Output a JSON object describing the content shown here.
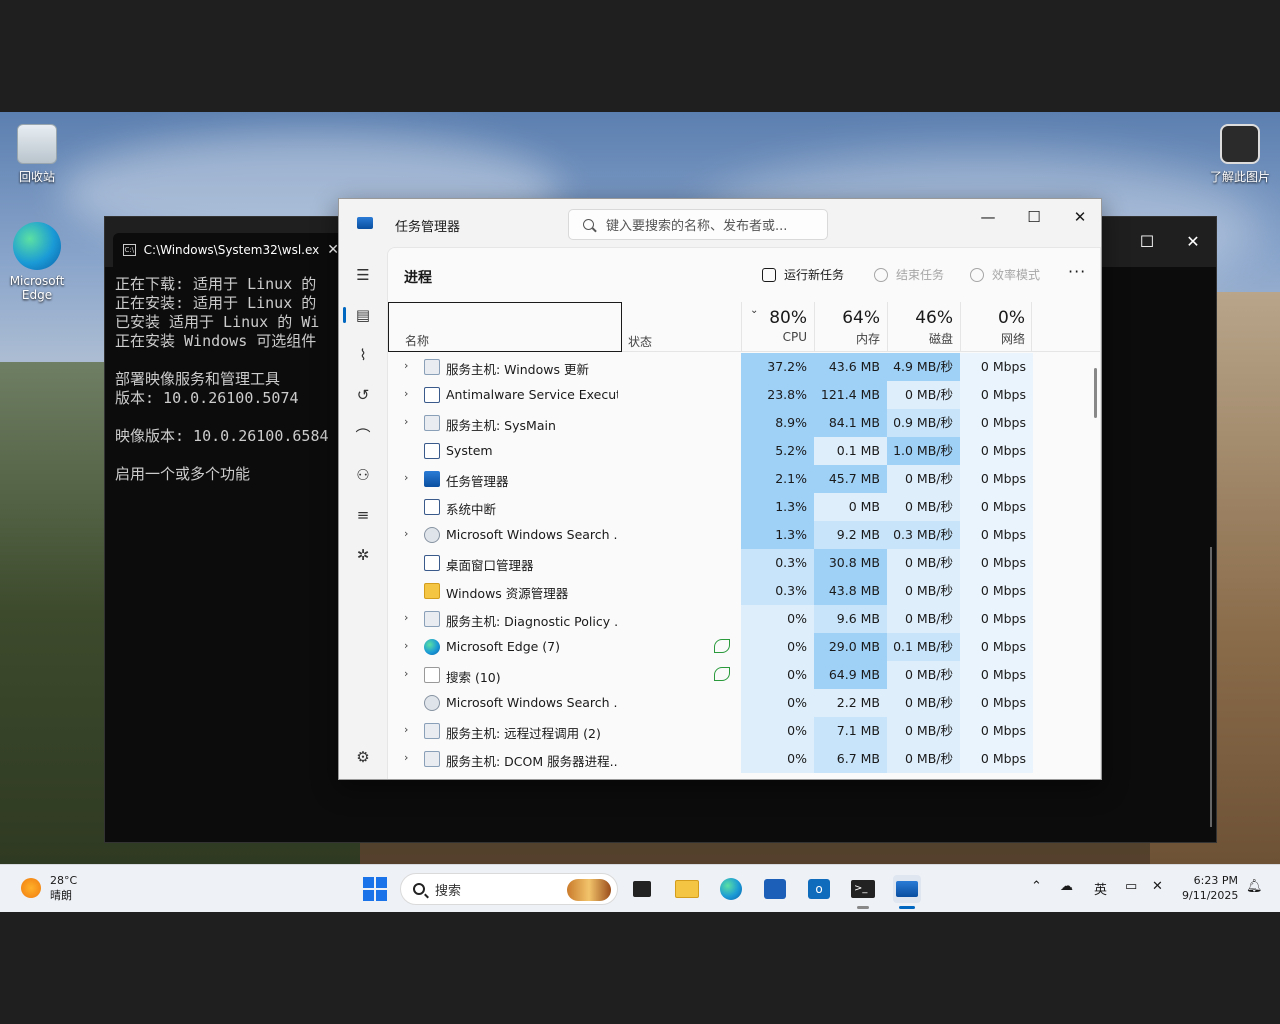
{
  "desktop": {
    "icons": [
      {
        "label": "回收站"
      },
      {
        "label": "Microsoft Edge"
      },
      {
        "label": "了解此图片"
      }
    ]
  },
  "cmd": {
    "tab_title": "C:\\Windows\\System32\\wsl.ex",
    "lines": [
      "正在下载: 适用于 Linux 的",
      "正在安装: 适用于 Linux 的",
      "已安装 适用于 Linux 的 Wi",
      "正在安装 Windows 可选组件",
      "",
      "部署映像服务和管理工具",
      "版本: 10.0.26100.5074",
      "",
      "映像版本: 10.0.26100.6584",
      "",
      "启用一个或多个功能"
    ]
  },
  "taskmgr": {
    "title": "任务管理器",
    "search_placeholder": "键入要搜索的名称、发布者或...",
    "page_title": "进程",
    "toolbar": {
      "run_new_task": "运行新任务",
      "end_task": "结束任务",
      "efficiency_mode": "效率模式",
      "more": "···"
    },
    "columns": {
      "name": "名称",
      "status": "状态",
      "cpu_pct": "80%",
      "cpu": "CPU",
      "mem_pct": "64%",
      "mem": "内存",
      "disk_pct": "46%",
      "disk": "磁盘",
      "net_pct": "0%",
      "net": "网络"
    },
    "processes": [
      {
        "name": "服务主机: Windows 更新",
        "icon": "gear-icon",
        "expandable": true,
        "eco": false,
        "cpu": "37.2%",
        "mem": "43.6 MB",
        "disk": "4.9 MB/秒",
        "net": "0 Mbps"
      },
      {
        "name": "Antimalware Service Execut...",
        "icon": "app-icon",
        "expandable": true,
        "eco": false,
        "cpu": "23.8%",
        "mem": "121.4 MB",
        "disk": "0 MB/秒",
        "net": "0 Mbps"
      },
      {
        "name": "服务主机: SysMain",
        "icon": "gear-icon",
        "expandable": true,
        "eco": false,
        "cpu": "8.9%",
        "mem": "84.1 MB",
        "disk": "0.9 MB/秒",
        "net": "0 Mbps"
      },
      {
        "name": "System",
        "icon": "app-icon",
        "expandable": false,
        "eco": false,
        "cpu": "5.2%",
        "mem": "0.1 MB",
        "disk": "1.0 MB/秒",
        "net": "0 Mbps"
      },
      {
        "name": "任务管理器",
        "icon": "taskmgr-icon",
        "expandable": true,
        "eco": false,
        "cpu": "2.1%",
        "mem": "45.7 MB",
        "disk": "0 MB/秒",
        "net": "0 Mbps"
      },
      {
        "name": "系统中断",
        "icon": "app-icon",
        "expandable": false,
        "eco": false,
        "cpu": "1.3%",
        "mem": "0 MB",
        "disk": "0 MB/秒",
        "net": "0 Mbps"
      },
      {
        "name": "Microsoft Windows Search ...",
        "icon": "user-icon",
        "expandable": true,
        "eco": false,
        "cpu": "1.3%",
        "mem": "9.2 MB",
        "disk": "0.3 MB/秒",
        "net": "0 Mbps"
      },
      {
        "name": "桌面窗口管理器",
        "icon": "app-icon",
        "expandable": false,
        "eco": false,
        "cpu": "0.3%",
        "mem": "30.8 MB",
        "disk": "0 MB/秒",
        "net": "0 Mbps"
      },
      {
        "name": "Windows 资源管理器",
        "icon": "folder-icon",
        "expandable": false,
        "eco": false,
        "cpu": "0.3%",
        "mem": "43.8 MB",
        "disk": "0 MB/秒",
        "net": "0 Mbps"
      },
      {
        "name": "服务主机: Diagnostic Policy ...",
        "icon": "gear-icon",
        "expandable": true,
        "eco": false,
        "cpu": "0%",
        "mem": "9.6 MB",
        "disk": "0 MB/秒",
        "net": "0 Mbps"
      },
      {
        "name": "Microsoft Edge (7)",
        "icon": "edge-icon",
        "expandable": true,
        "eco": true,
        "cpu": "0%",
        "mem": "29.0 MB",
        "disk": "0.1 MB/秒",
        "net": "0 Mbps"
      },
      {
        "name": "搜索 (10)",
        "icon": "search-app-icon",
        "expandable": true,
        "eco": true,
        "cpu": "0%",
        "mem": "64.9 MB",
        "disk": "0 MB/秒",
        "net": "0 Mbps"
      },
      {
        "name": "Microsoft Windows Search ...",
        "icon": "user-icon",
        "expandable": false,
        "eco": false,
        "cpu": "0%",
        "mem": "2.2 MB",
        "disk": "0 MB/秒",
        "net": "0 Mbps"
      },
      {
        "name": "服务主机: 远程过程调用 (2)",
        "icon": "gear-icon",
        "expandable": true,
        "eco": false,
        "cpu": "0%",
        "mem": "7.1 MB",
        "disk": "0 MB/秒",
        "net": "0 Mbps"
      },
      {
        "name": "服务主机: DCOM 服务器进程...",
        "icon": "gear-icon",
        "expandable": true,
        "eco": false,
        "cpu": "0%",
        "mem": "6.7 MB",
        "disk": "0 MB/秒",
        "net": "0 Mbps"
      }
    ]
  },
  "taskbar": {
    "weather_temp": "28°C",
    "weather_desc": "晴朗",
    "search_label": "搜索",
    "tray_ime": "英",
    "time": "6:23 PM",
    "date": "9/11/2025"
  }
}
